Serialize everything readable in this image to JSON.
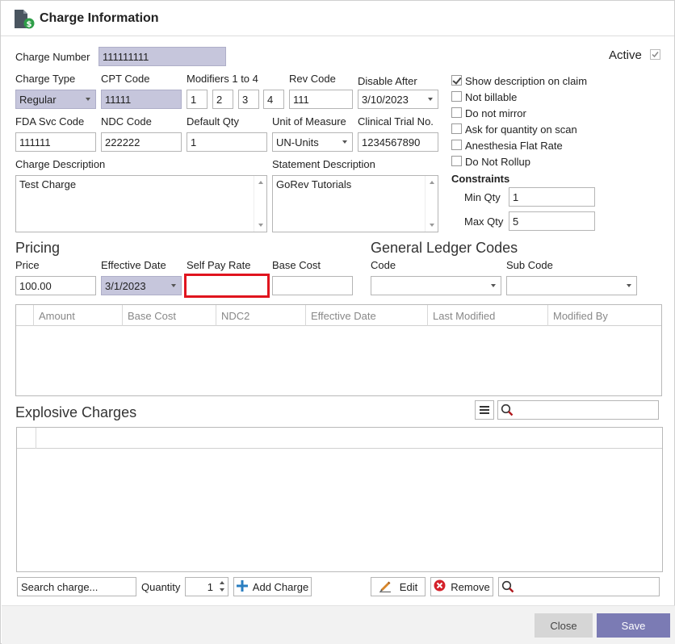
{
  "window": {
    "title": "Charge Information"
  },
  "active": {
    "label": "Active",
    "checked": true
  },
  "fields": {
    "charge_number": {
      "label": "Charge Number",
      "value": "111111111"
    },
    "charge_type": {
      "label": "Charge Type",
      "value": "Regular"
    },
    "cpt_code": {
      "label": "CPT Code",
      "value": "11111"
    },
    "modifiers": {
      "label": "Modifiers 1 to 4",
      "values": [
        "1",
        "2",
        "3",
        "4"
      ]
    },
    "rev_code": {
      "label": "Rev Code",
      "value": "111"
    },
    "disable_after": {
      "label": "Disable After",
      "value": "3/10/2023"
    },
    "fda_svc_code": {
      "label": "FDA Svc Code",
      "value": "111111"
    },
    "ndc_code": {
      "label": "NDC Code",
      "value": "222222"
    },
    "default_qty": {
      "label": "Default Qty",
      "value": "1"
    },
    "unit_of_measure": {
      "label": "Unit of Measure",
      "value": "UN-Units"
    },
    "clinical_trial": {
      "label": "Clinical Trial No.",
      "value": "1234567890"
    },
    "charge_description": {
      "label": "Charge Description",
      "value": "Test Charge"
    },
    "statement_description": {
      "label": "Statement Description",
      "value": "GoRev Tutorials"
    }
  },
  "options": [
    {
      "label": "Show description on claim",
      "checked": true
    },
    {
      "label": "Not billable",
      "checked": false
    },
    {
      "label": "Do not mirror",
      "checked": false
    },
    {
      "label": "Ask for quantity on scan",
      "checked": false
    },
    {
      "label": "Anesthesia Flat Rate",
      "checked": false
    },
    {
      "label": "Do Not Rollup",
      "checked": false
    }
  ],
  "constraints": {
    "heading": "Constraints",
    "min_qty": {
      "label": "Min Qty",
      "value": "1"
    },
    "max_qty": {
      "label": "Max Qty",
      "value": "5"
    }
  },
  "pricing": {
    "heading": "Pricing",
    "price": {
      "label": "Price",
      "value": "100.00"
    },
    "effective_date": {
      "label": "Effective Date",
      "value": "3/1/2023"
    },
    "self_pay_rate": {
      "label": "Self Pay Rate",
      "value": ""
    },
    "base_cost": {
      "label": "Base Cost",
      "value": ""
    },
    "highlight_color": "#e0141e"
  },
  "gl_codes": {
    "heading": "General Ledger Codes",
    "code": {
      "label": "Code",
      "value": ""
    },
    "sub_code": {
      "label": "Sub Code",
      "value": ""
    }
  },
  "pricing_grid": {
    "columns": [
      "Amount",
      "Base Cost",
      "NDC2",
      "Effective Date",
      "Last Modified",
      "Modified By"
    ]
  },
  "explosive": {
    "heading": "Explosive Charges",
    "search_charge_placeholder": "Search charge...",
    "quantity_label": "Quantity",
    "quantity_value": "1",
    "add_charge_label": "Add Charge",
    "edit_label": "Edit",
    "remove_label": "Remove"
  },
  "footer": {
    "close_label": "Close",
    "save_label": "Save",
    "save_color": "#7b7bb4"
  }
}
